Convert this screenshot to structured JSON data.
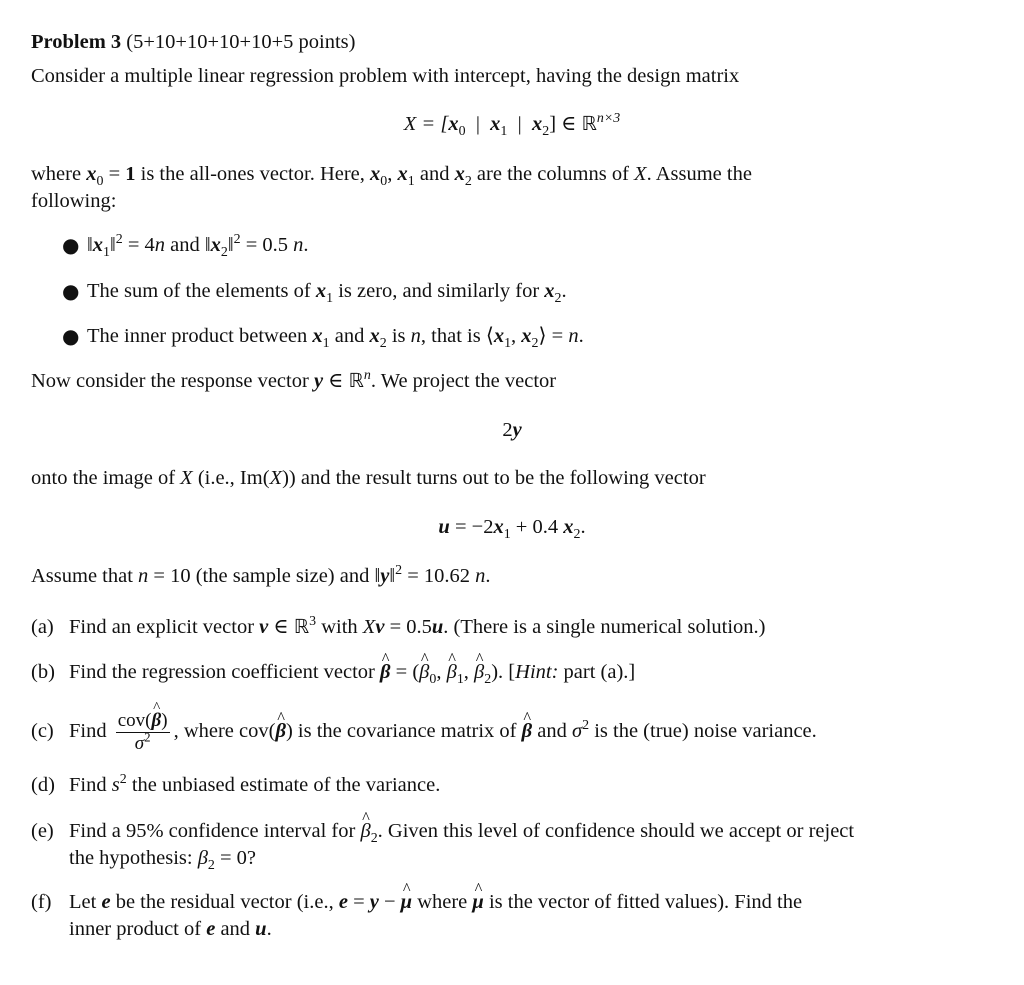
{
  "header": {
    "title": "Problem 3",
    "points": "(5+10+10+10+10+5 points)"
  },
  "intro": {
    "line1": "Consider a multiple linear regression problem with intercept, having the design matrix",
    "matrix_eq": {
      "lhs": "X = [",
      "col0": "x",
      "col0_sub": "0",
      "sep": "|",
      "col1": "x",
      "col1_sub": "1",
      "col2": "x",
      "col2_sub": "2",
      "rhs": "] ∈ ",
      "field": "ℝ",
      "dim": "n×3"
    },
    "where_line": {
      "t1": "where ",
      "x0": "x",
      "x0_sub": "0",
      "eq": " = ",
      "one": "1",
      "t2": " is the all-ones vector.  Here, ",
      "xs": "x",
      "s0": "0",
      "comma": ", ",
      "s1": "1",
      "and": " and ",
      "s2": "2",
      "t3": " are the columns of ",
      "X": "X",
      "t4": ".  Assume the"
    },
    "following": "following:"
  },
  "assumptions": [
    {
      "p1": "‖",
      "x": "x",
      "s1": "1",
      "p2": "‖",
      "sq": "2",
      "p3": " = 4",
      "n": "n",
      "and": " and ",
      "s2": "2",
      "p4": " = 0.5 ",
      "end": "."
    },
    {
      "t1": "The sum of the elements of ",
      "x": "x",
      "s1": "1",
      "t2": " is zero, and similarly for ",
      "s2": "2",
      "end": "."
    },
    {
      "t1": "The inner product between ",
      "x": "x",
      "s1": "1",
      "and": " and ",
      "s2": "2",
      "t2": " is ",
      "n": "n",
      "t3": ", that is ⟨",
      "comma": ", ",
      "t4": "⟩ = ",
      "end": "."
    }
  ],
  "response": {
    "t1": "Now consider the response vector ",
    "y": "y",
    "in": " ∈ ",
    "field": "ℝ",
    "n": "n",
    "t2": ". We project the vector",
    "display": "2",
    "display_y": "y",
    "onto1": "onto the image of ",
    "X": "X",
    "onto2": " (i.e., Im(",
    "onto3": ")) and the result turns out to be the following vector",
    "u": "u",
    "u_eq": " = −2",
    "x": "x",
    "s1": "1",
    "plus": " + 0.4 ",
    "s2": "2",
    "end": "."
  },
  "assume": {
    "t1": "Assume that ",
    "n": "n",
    "t2": " = 10 (the sample size) and ‖",
    "y": "y",
    "t3": "‖",
    "sq": "2",
    "t4": " = 10.62 ",
    "end": "."
  },
  "parts": [
    {
      "label": "(a)",
      "t1": "Find an explicit vector ",
      "v": "v",
      "in": " ∈ ",
      "field": "ℝ",
      "dim": "3",
      "t2": " with ",
      "X": "X",
      "eq": " = 0.5",
      "u": "u",
      "t3": ". (There is a single numerical solution.)"
    },
    {
      "label": "(b)",
      "t1": "Find the regression coefficient vector ",
      "beta": "β",
      "eq": " = (",
      "s0": "0",
      "comma": ", ",
      "s1": "1",
      "s2": "2",
      "t2": "). [",
      "hint": "Hint:",
      "t3": " part (a).]"
    },
    {
      "label": "(c)",
      "find": "Find",
      "num": "cov(",
      "beta": "β",
      "num_end": ")",
      "den": "σ",
      "den_sq": "2",
      "t1": ", where cov(",
      "t2": ") is the covariance matrix of ",
      "t3": " and ",
      "t4": " is the (true) noise variance."
    },
    {
      "label": "(d)",
      "t1": "Find ",
      "s": "s",
      "sq": "2",
      "t2": " the unbiased estimate of the variance."
    },
    {
      "label": "(e)",
      "t1": "Find a 95% confidence interval for ",
      "beta": "β",
      "s2": "2",
      "t2": ". Given this level of confidence should we accept or reject",
      "line2a": "the hypothesis: ",
      "line2b": " = 0?"
    },
    {
      "label": "(f)",
      "t1": "Let ",
      "e": "e",
      "t2": " be the residual vector (i.e., ",
      "eq": " = ",
      "y": "y",
      "minus": " − ",
      "mu": "μ",
      "t3": " where ",
      "t4": " is the vector of fitted values). Find the",
      "line2a": "inner product of ",
      "and": " and ",
      "u": "u",
      "end": "."
    }
  ]
}
